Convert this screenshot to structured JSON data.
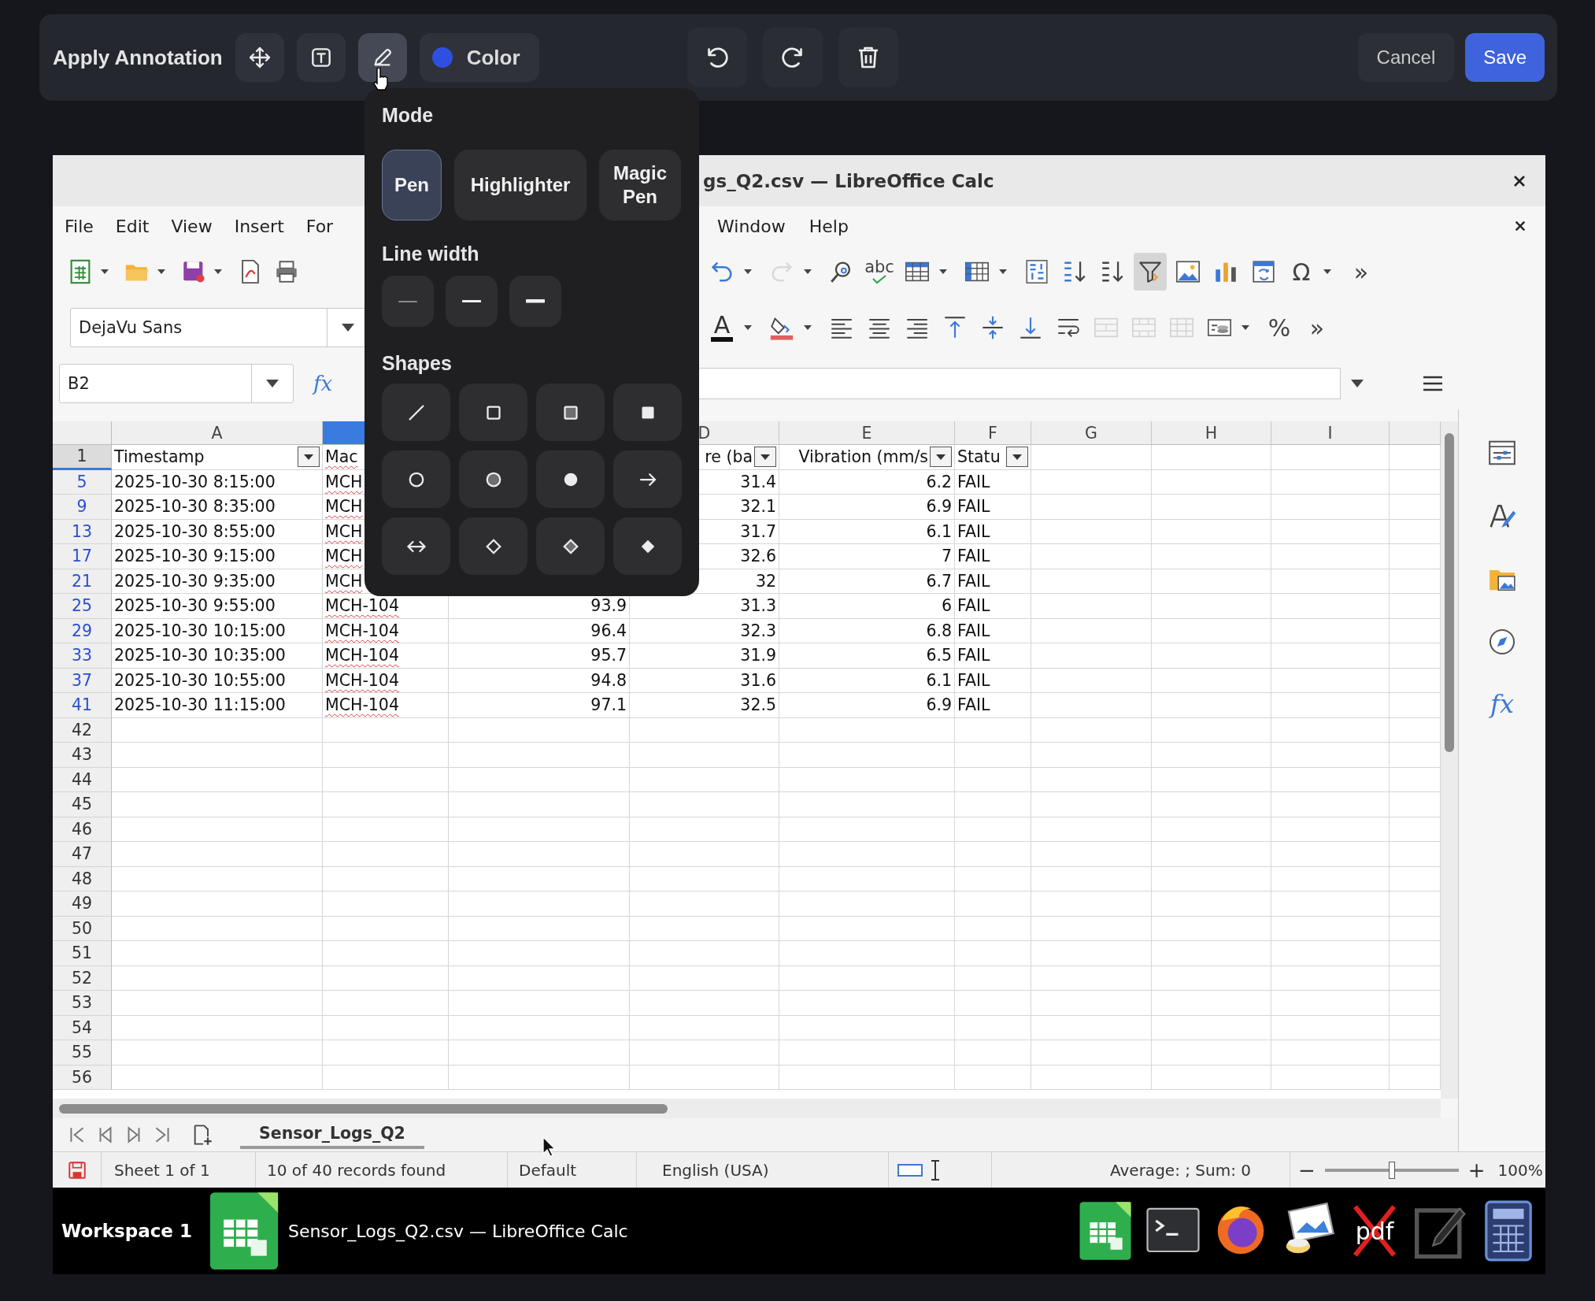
{
  "annotation_toolbar": {
    "title": "Apply Annotation",
    "tools": [
      {
        "kind": "move",
        "selected": false
      },
      {
        "kind": "text",
        "selected": false
      },
      {
        "kind": "pen",
        "selected": true
      }
    ],
    "color": {
      "label": "Color",
      "color": "#2f4fe0"
    },
    "actions": [
      {
        "kind": "undo"
      },
      {
        "kind": "redo"
      },
      {
        "kind": "delete"
      }
    ],
    "cancel": "Cancel",
    "save": "Save"
  },
  "pen_popup": {
    "mode_heading": "Mode",
    "modes": [
      {
        "label": "Pen",
        "selected": true
      },
      {
        "label": "Highlighter",
        "selected": false
      },
      {
        "label": "Magic Pen",
        "selected": false
      }
    ],
    "line_width_heading": "Line width",
    "line_widths": [
      {
        "kind": "thin"
      },
      {
        "kind": "medium"
      },
      {
        "kind": "thick"
      }
    ],
    "shapes_heading": "Shapes",
    "shapes": [
      {
        "kind": "line"
      },
      {
        "kind": "square"
      },
      {
        "kind": "square-half"
      },
      {
        "kind": "square-filled"
      },
      {
        "kind": "circle"
      },
      {
        "kind": "circle-half"
      },
      {
        "kind": "circle-filled"
      },
      {
        "kind": "arrow"
      },
      {
        "kind": "double-arrow"
      },
      {
        "kind": "diamond"
      },
      {
        "kind": "diamond-half"
      },
      {
        "kind": "diamond-filled"
      }
    ]
  },
  "calc_window": {
    "title": "gs_Q2.csv — LibreOffice Calc",
    "menu": [
      "File",
      "Edit",
      "View",
      "Insert",
      "For"
    ],
    "menu_right": [
      "Window",
      "Help"
    ],
    "toolbar_1": {
      "left": [
        {
          "kind": "new-sheet",
          "menu": true
        },
        {
          "kind": "open",
          "menu": true
        },
        {
          "kind": "save",
          "menu": true
        },
        {
          "kind": "export-pdf",
          "menu": false
        },
        {
          "kind": "print",
          "menu": false
        }
      ],
      "right": [
        {
          "kind": "undo",
          "menu": true,
          "active": false,
          "disabled": false
        },
        {
          "kind": "redo",
          "menu": true,
          "active": false,
          "disabled": true
        },
        {
          "kind": "find-replace",
          "menu": false,
          "active": false,
          "disabled": false
        },
        {
          "kind": "spellcheck",
          "text": "abc",
          "menu": false,
          "active": false,
          "disabled": false
        },
        {
          "kind": "rows",
          "menu": true,
          "active": false,
          "disabled": false
        },
        {
          "kind": "columns",
          "menu": true,
          "active": false,
          "disabled": false
        },
        {
          "kind": "sort",
          "menu": false,
          "active": false,
          "disabled": false
        },
        {
          "kind": "sort-ascending",
          "menu": false,
          "active": false,
          "disabled": false
        },
        {
          "kind": "sort-descending",
          "menu": false,
          "active": false,
          "disabled": false
        },
        {
          "kind": "autofilter",
          "menu": false,
          "active": true,
          "disabled": false
        },
        {
          "kind": "image",
          "menu": false,
          "active": false,
          "disabled": false
        },
        {
          "kind": "chart",
          "menu": false,
          "active": false,
          "disabled": false
        },
        {
          "kind": "pivot",
          "menu": false,
          "active": false,
          "disabled": false
        },
        {
          "kind": "special-character",
          "text": "Ω",
          "menu": true,
          "active": false,
          "disabled": false
        },
        {
          "kind": "more",
          "text": "»",
          "menu": false,
          "active": false,
          "disabled": false
        }
      ]
    },
    "font_name": "DejaVu Sans",
    "toolbar_2": [
      {
        "kind": "font-color",
        "text": "A",
        "menu": true,
        "disabled": false
      },
      {
        "kind": "highlight",
        "menu": true,
        "disabled": false
      },
      {
        "kind": "align-left",
        "menu": false,
        "disabled": false
      },
      {
        "kind": "align-center",
        "menu": false,
        "disabled": false
      },
      {
        "kind": "align-right",
        "menu": false,
        "disabled": false
      },
      {
        "kind": "align-top",
        "menu": false,
        "disabled": false
      },
      {
        "kind": "align-middle",
        "menu": false,
        "disabled": false
      },
      {
        "kind": "align-bottom",
        "menu": false,
        "disabled": false
      },
      {
        "kind": "wrap",
        "menu": false,
        "disabled": false
      },
      {
        "kind": "merge",
        "menu": false,
        "disabled": true
      },
      {
        "kind": "merge-center",
        "menu": false,
        "disabled": true
      },
      {
        "kind": "unmerge",
        "menu": false,
        "disabled": true
      },
      {
        "kind": "number-format",
        "menu": true,
        "disabled": false
      },
      {
        "kind": "percent",
        "text": "%",
        "menu": false,
        "disabled": false
      },
      {
        "kind": "more",
        "text": "»",
        "menu": false,
        "disabled": false
      }
    ],
    "name_box": "B2",
    "function_wizard": "fx",
    "columns": [
      {
        "label": "A",
        "selected": false
      },
      {
        "selected": true
      },
      {
        "label": "D",
        "selected": false
      },
      {
        "label": "E",
        "selected": false
      },
      {
        "label": "F",
        "selected": false
      },
      {
        "label": "G",
        "selected": false
      },
      {
        "label": "H",
        "selected": false
      },
      {
        "label": "I",
        "selected": false
      },
      {
        "selected": false
      }
    ],
    "header_row": {
      "number": "1",
      "filtered": false,
      "selected": true,
      "a": {
        "text": "Timestamp",
        "filter": true
      },
      "b": {
        "text": "Mac",
        "filter": false
      },
      "d": {
        "text": "re (ba",
        "filter": true
      },
      "e": {
        "text": "Vibration (mm/s",
        "filter": true
      },
      "f": {
        "text": "Statu",
        "filter": true
      }
    },
    "rows": [
      {
        "number": "5",
        "filtered": true,
        "selected": false,
        "a": "2025-10-30 8:15:00",
        "b": "MCH",
        "d": "31.4",
        "e": "6.2",
        "f": "FAIL"
      },
      {
        "number": "9",
        "filtered": true,
        "selected": false,
        "a": "2025-10-30 8:35:00",
        "b": "MCH",
        "d": "32.1",
        "e": "6.9",
        "f": "FAIL"
      },
      {
        "number": "13",
        "filtered": true,
        "selected": false,
        "a": "2025-10-30 8:55:00",
        "b": "MCH",
        "d": "31.7",
        "e": "6.1",
        "f": "FAIL"
      },
      {
        "number": "17",
        "filtered": true,
        "selected": false,
        "a": "2025-10-30 9:15:00",
        "b": "MCH",
        "d": "32.6",
        "e": "7",
        "f": "FAIL"
      },
      {
        "number": "21",
        "filtered": true,
        "selected": false,
        "a": "2025-10-30 9:35:00",
        "b": "MCH",
        "d": "32",
        "e": "6.7",
        "f": "FAIL"
      },
      {
        "number": "25",
        "filtered": true,
        "selected": false,
        "a": "2025-10-30 9:55:00",
        "b": "MCH-104",
        "c": "93.9",
        "d": "31.3",
        "e": "6",
        "f": "FAIL"
      },
      {
        "number": "29",
        "filtered": true,
        "selected": false,
        "a": "2025-10-30 10:15:00",
        "b": "MCH-104",
        "c": "96.4",
        "d": "32.3",
        "e": "6.8",
        "f": "FAIL"
      },
      {
        "number": "33",
        "filtered": true,
        "selected": false,
        "a": "2025-10-30 10:35:00",
        "b": "MCH-104",
        "c": "95.7",
        "d": "31.9",
        "e": "6.5",
        "f": "FAIL"
      },
      {
        "number": "37",
        "filtered": true,
        "selected": false,
        "a": "2025-10-30 10:55:00",
        "b": "MCH-104",
        "c": "94.8",
        "d": "31.6",
        "e": "6.1",
        "f": "FAIL"
      },
      {
        "number": "41",
        "filtered": true,
        "selected": false,
        "a": "2025-10-30 11:15:00",
        "b": "MCH-104",
        "c": "97.1",
        "d": "32.5",
        "e": "6.9",
        "f": "FAIL"
      },
      {
        "number": "42",
        "filtered": false,
        "selected": false
      },
      {
        "number": "43",
        "filtered": false,
        "selected": false
      },
      {
        "number": "44",
        "filtered": false,
        "selected": false
      },
      {
        "number": "45",
        "filtered": false,
        "selected": false
      },
      {
        "number": "46",
        "filtered": false,
        "selected": false
      },
      {
        "number": "47",
        "filtered": false,
        "selected": false
      },
      {
        "number": "48",
        "filtered": false,
        "selected": false
      },
      {
        "number": "49",
        "filtered": false,
        "selected": false
      },
      {
        "number": "50",
        "filtered": false,
        "selected": false
      },
      {
        "number": "51",
        "filtered": false,
        "selected": false
      },
      {
        "number": "52",
        "filtered": false,
        "selected": false
      },
      {
        "number": "53",
        "filtered": false,
        "selected": false
      },
      {
        "number": "54",
        "filtered": false,
        "selected": false
      },
      {
        "number": "55",
        "filtered": false,
        "selected": false
      },
      {
        "number": "56",
        "filtered": false,
        "selected": false
      }
    ],
    "sidebar": [
      {
        "kind": "properties"
      },
      {
        "kind": "styles"
      },
      {
        "kind": "gallery"
      },
      {
        "kind": "navigator"
      },
      {
        "kind": "functions",
        "text": "fx"
      }
    ],
    "sheet_tab": "Sensor_Logs_Q2",
    "status": {
      "sheet": "Sheet 1 of 1",
      "records": "10 of 40 records found",
      "style": "Default",
      "language": "English (USA)",
      "sum": "Average: ; Sum: 0",
      "zoom_out": "−",
      "zoom_in": "+",
      "zoom": {
        "level": 0.5
      },
      "zoom_text": "100%"
    }
  },
  "taskbar": {
    "workspace": "Workspace 1",
    "task": "Sensor_Logs_Q2.csv — LibreOffice Calc",
    "launchers": [
      {
        "kind": "spreadsheet"
      },
      {
        "kind": "terminal"
      },
      {
        "kind": "browser"
      },
      {
        "kind": "image-viewer"
      },
      {
        "kind": "pdf",
        "text": "pdf"
      },
      {
        "kind": "editor"
      },
      {
        "kind": "calculator"
      }
    ]
  }
}
